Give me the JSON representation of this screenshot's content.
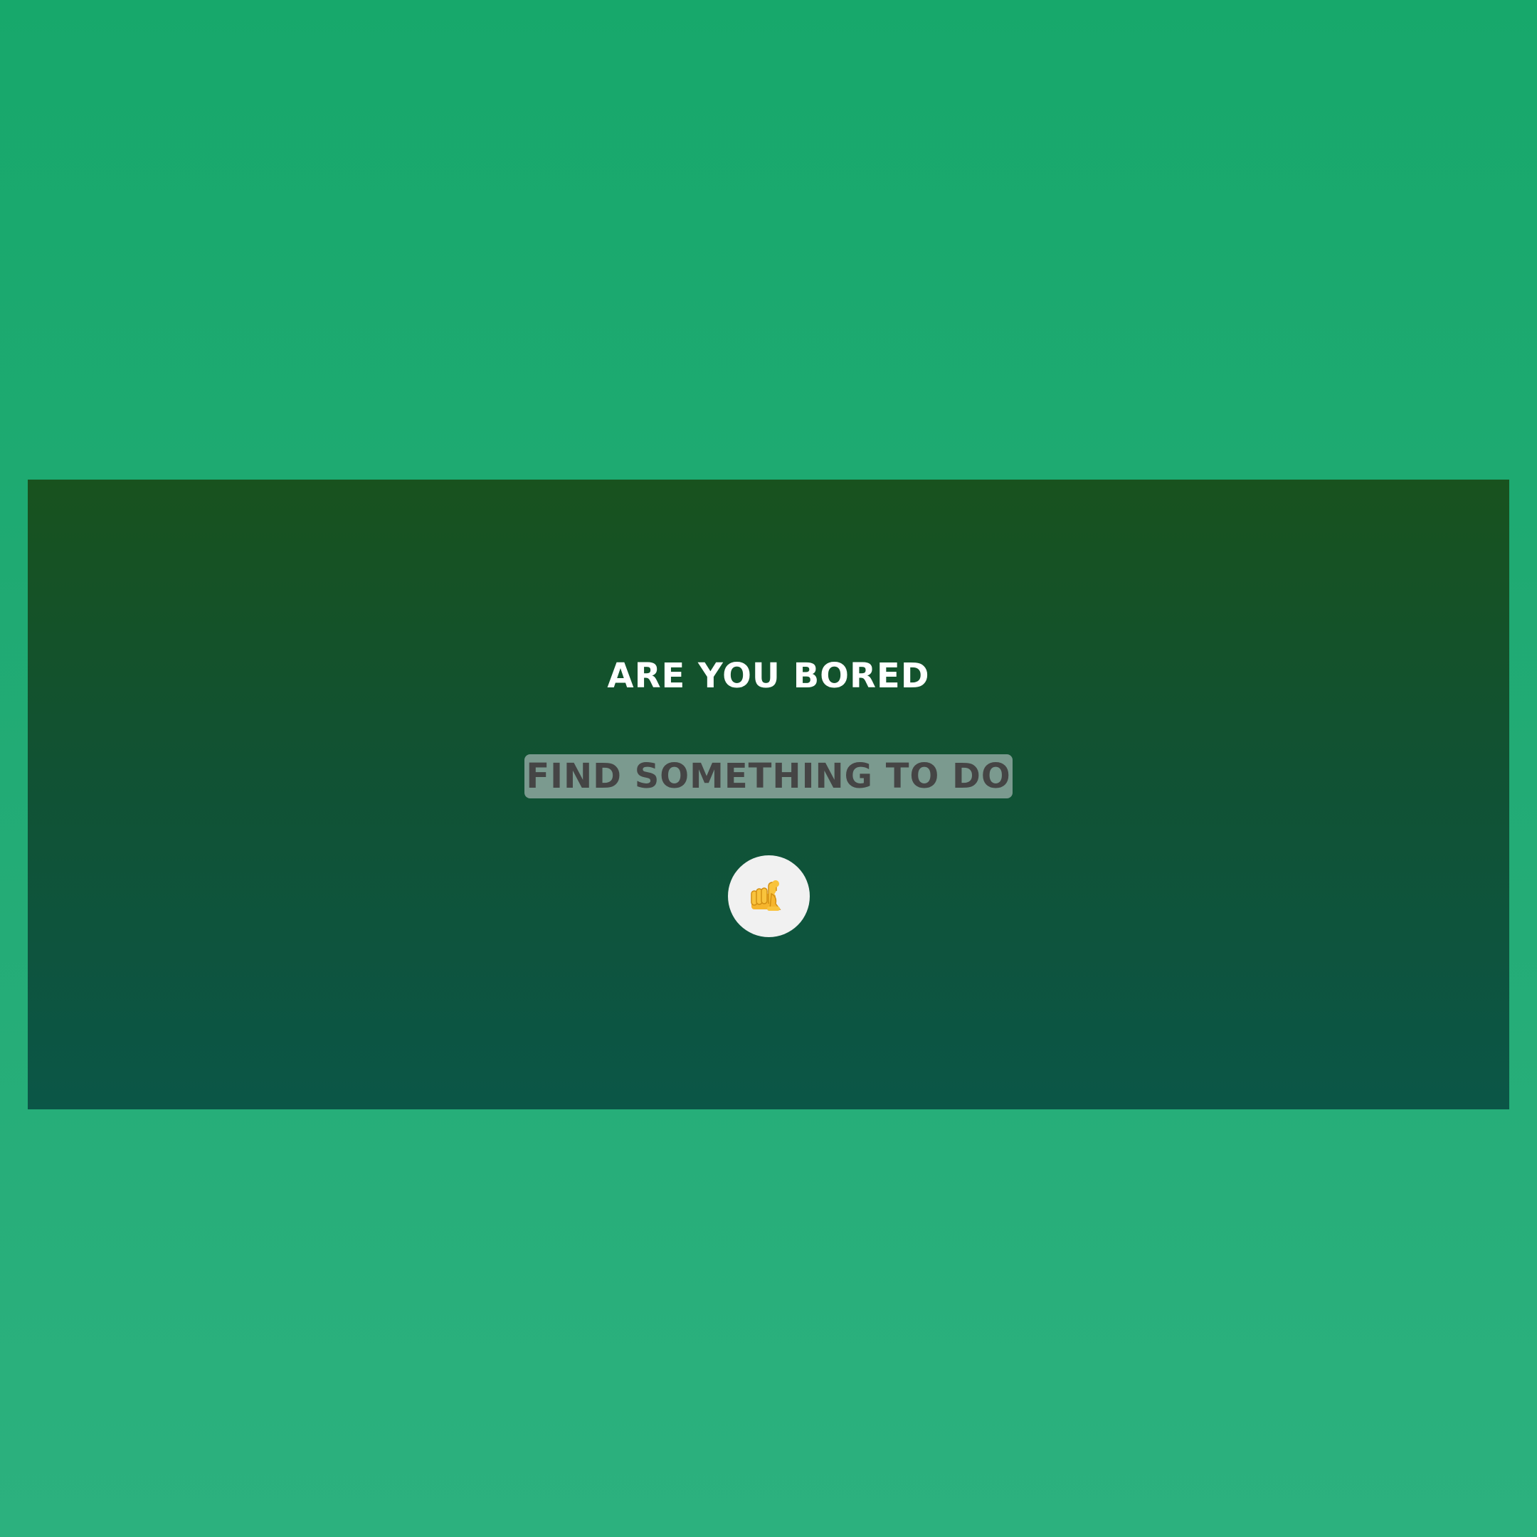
{
  "card": {
    "headline": "ARE YOU BORED",
    "cta_label": "FIND SOMETHING TO DO",
    "emoji_button_icon": "pointing-hand-icon"
  },
  "colors": {
    "page_background": "#22ab75",
    "card_top": "#18521e",
    "card_bottom": "#0b5647",
    "headline_text": "#ffffff",
    "cta_background": "#7b9a8f",
    "cta_text": "#454545",
    "emoji_button_background": "#f1f1f1",
    "emoji_color": "#f6b52d"
  }
}
